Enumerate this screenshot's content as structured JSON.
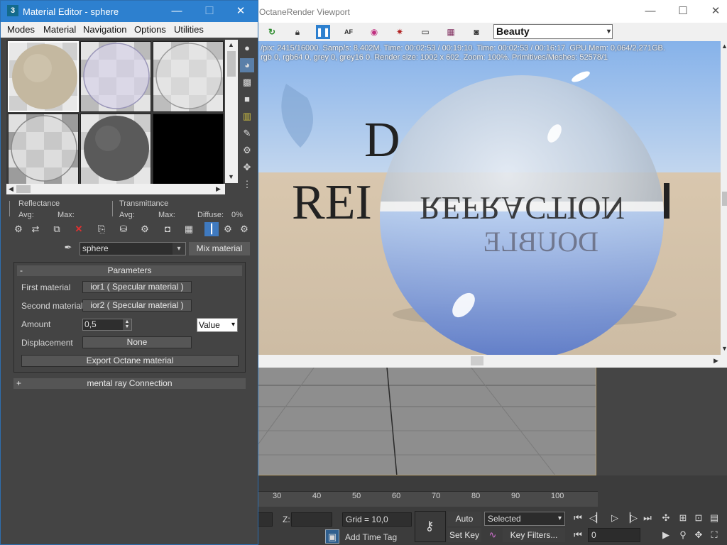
{
  "material_editor": {
    "title": "Material Editor - sphere",
    "menu": [
      "Modes",
      "Material",
      "Navigation",
      "Options",
      "Utilities"
    ],
    "stats": {
      "reflectance": "Reflectance",
      "transmittance": "Transmittance",
      "avg": "Avg:",
      "max": "Max:",
      "diffuse": "Diffuse:",
      "diffuse_value": "0%"
    },
    "material_name": "sphere",
    "material_type_button": "Mix material",
    "parameters": {
      "header": "Parameters",
      "first_material_label": "First material",
      "first_material_value": "ior1  ( Specular material )",
      "second_material_label": "Second material",
      "second_material_value": "ior2  ( Specular material )",
      "amount_label": "Amount",
      "amount_value": "0,5",
      "amount_mode": "Value",
      "displacement_label": "Displacement",
      "displacement_value": "None",
      "export_button": "Export Octane material"
    },
    "mental_ray": {
      "header": "mental ray Connection"
    },
    "collapse_symbol": "-",
    "expand_symbol": "+"
  },
  "octane": {
    "title": "OctaneRender Viewport",
    "render_pass": "Beauty",
    "info_line1": "/pix: 2415/16000.   Samp/s: 8,402M.   Time: 00:02:53 / 00:19:10.   Time: 00:02:53 / 00:16:17.   GPU Mem: 0,064/2,271GB.",
    "info_line2": "rgb 0, rgb64 0, grey 0, grey16 0.   Render size: 1002 x 602.   Zoom: 100%.   Primitives/Meshes: 52578/1",
    "scene_text": {
      "line_top": "D",
      "line_mid": "REI",
      "refracted": "REFRACTION",
      "refracted2": "DOUBLE"
    }
  },
  "max": {
    "ruler_ticks": [
      "30",
      "40",
      "50",
      "60",
      "70",
      "80",
      "90",
      "100"
    ],
    "z_label": "Z:",
    "grid": "Grid = 10,0",
    "auto_key": "Auto Key",
    "selected": "Selected",
    "set_key": "Set Key",
    "key_filters": "Key Filters...",
    "add_time_tag": "Add Time Tag",
    "frame": "0"
  },
  "colors": {
    "title_blue": "#2d80cf",
    "sky": "#9cc0ec",
    "floor": "#d2c0a8",
    "panel": "#444444"
  }
}
